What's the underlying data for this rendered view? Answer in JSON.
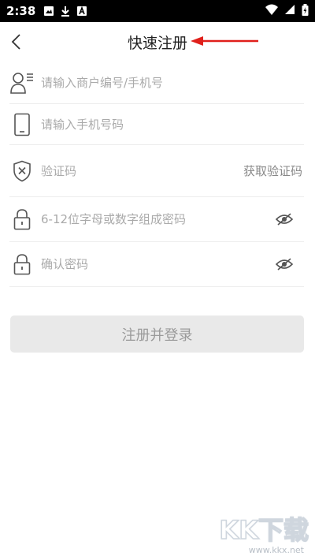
{
  "status_bar": {
    "time": "2:38"
  },
  "header": {
    "title": "快速注册"
  },
  "form": {
    "merchant": {
      "placeholder": "请输入商户编号/手机号"
    },
    "phone": {
      "placeholder": "请输入手机号码"
    },
    "code": {
      "placeholder": "验证码",
      "get_code_label": "获取验证码"
    },
    "password": {
      "placeholder": "6-12位字母或数字组成密码"
    },
    "confirm": {
      "placeholder": "确认密码"
    }
  },
  "submit": {
    "label": "注册并登录"
  },
  "watermark": {
    "logo_text": "KK下载",
    "url": "www.kkx.net"
  },
  "colors": {
    "arrow": "#e0201b",
    "divider": "#ececec",
    "button_bg": "#e9e9e9"
  },
  "icons": [
    "image-icon",
    "download-icon",
    "app-icon",
    "wifi-icon",
    "signal-icon",
    "battery-icon",
    "back-arrow-icon",
    "user-card-icon",
    "phone-icon",
    "shield-icon",
    "lock-icon",
    "eye-hidden-icon"
  ]
}
